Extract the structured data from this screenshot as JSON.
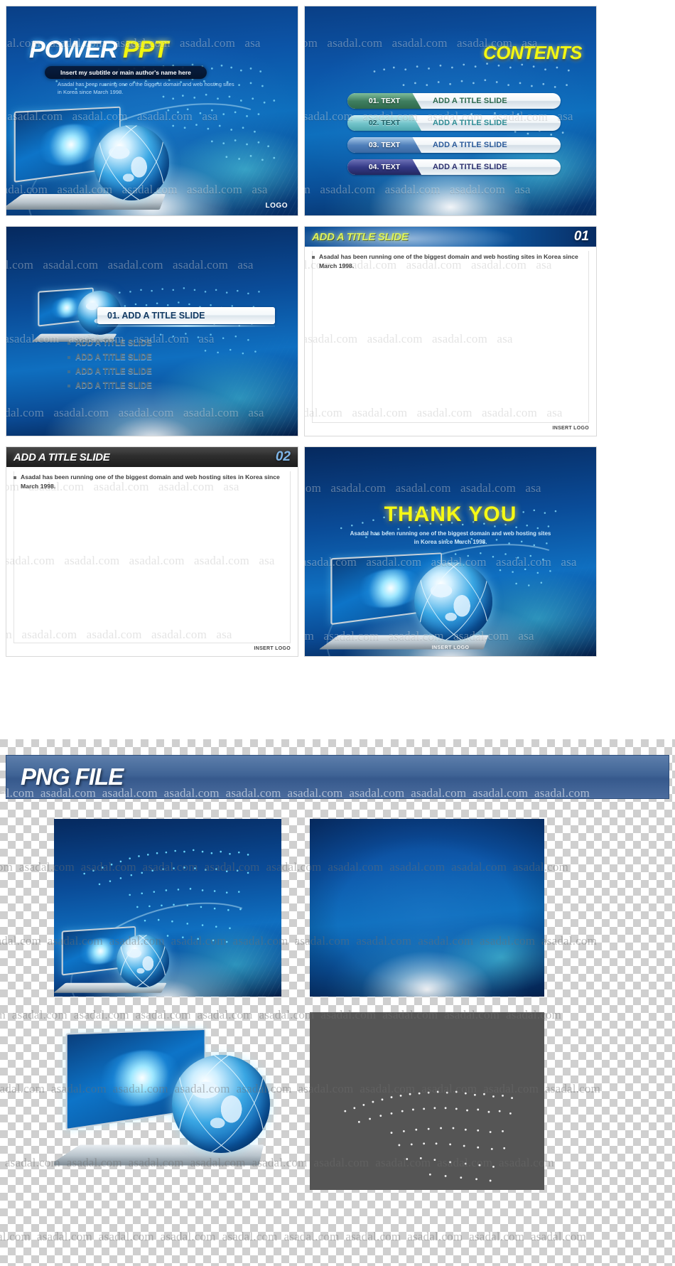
{
  "meta": {
    "watermark_text": "asadal.com"
  },
  "slides": [
    {
      "id": "title-slide",
      "title_main": "POWER",
      "title_accent": "PPT",
      "subtitle": "Insert my subtitle or main author's name here",
      "description": "Asadal has been running one of the biggest domain and web hosting sites in Korea since March 1998.",
      "logo": "LOGO"
    },
    {
      "id": "contents-slide",
      "title": "CONTENTS",
      "items": [
        {
          "number": "01. TEXT",
          "label": "ADD A TITLE SLIDE",
          "badge_color": "#4f8f70",
          "label_color": "#2d6a4f"
        },
        {
          "number": "02. TEXT",
          "label": "ADD A TITLE SLIDE",
          "badge_color": "#6fbfc6",
          "label_color": "#2f8e96"
        },
        {
          "number": "03. TEXT",
          "label": "ADD A TITLE SLIDE",
          "badge_color": "#5b84bd",
          "label_color": "#2c5b9a"
        },
        {
          "number": "04. TEXT",
          "label": "ADD A TITLE SLIDE",
          "badge_color": "#3b3f86",
          "label_color": "#2b2f6e"
        }
      ]
    },
    {
      "id": "section-slide",
      "title": "01. ADD A TITLE SLIDE",
      "bullets": [
        "ADD A TITLE SLIDE",
        "ADD A TITLE SLIDE",
        "ADD A TITLE SLIDE",
        "ADD A TITLE SLIDE"
      ]
    },
    {
      "id": "content-slide-blue",
      "title": "ADD A TITLE SLIDE",
      "number": "01",
      "body": "Asadal has been running one of the biggest domain and web hosting sites in Korea since March 1998.",
      "logo": "INSERT LOGO"
    },
    {
      "id": "content-slide-dark",
      "title": "ADD A TITLE SLIDE",
      "number": "02",
      "body": "Asadal has been running one of the biggest domain and web hosting sites in Korea since March 1998.",
      "logo": "INSERT LOGO"
    },
    {
      "id": "thank-you-slide",
      "title": "THANK YOU",
      "description": "Asadal has been running one of the biggest domain and web hosting sites in Korea since March 1998.",
      "logo": "INSERT LOGO"
    }
  ],
  "png_section": {
    "header_title": "PNG FILE",
    "assets": [
      {
        "id": "asset-bg-world-laptop",
        "kind": "blue-world-laptop"
      },
      {
        "id": "asset-bg-plain-blue",
        "kind": "blue-plain"
      },
      {
        "id": "asset-laptop-globe",
        "kind": "laptop-globe-cutout"
      },
      {
        "id": "asset-world-map-gray",
        "kind": "gray-world-map"
      }
    ]
  },
  "colors": {
    "brand_blue": "#0c55a8",
    "accent_yellow": "#f4f810",
    "accent_lime": "#ddf25a",
    "dark_header": "#2e2e2e",
    "png_header": "#3f6395"
  }
}
